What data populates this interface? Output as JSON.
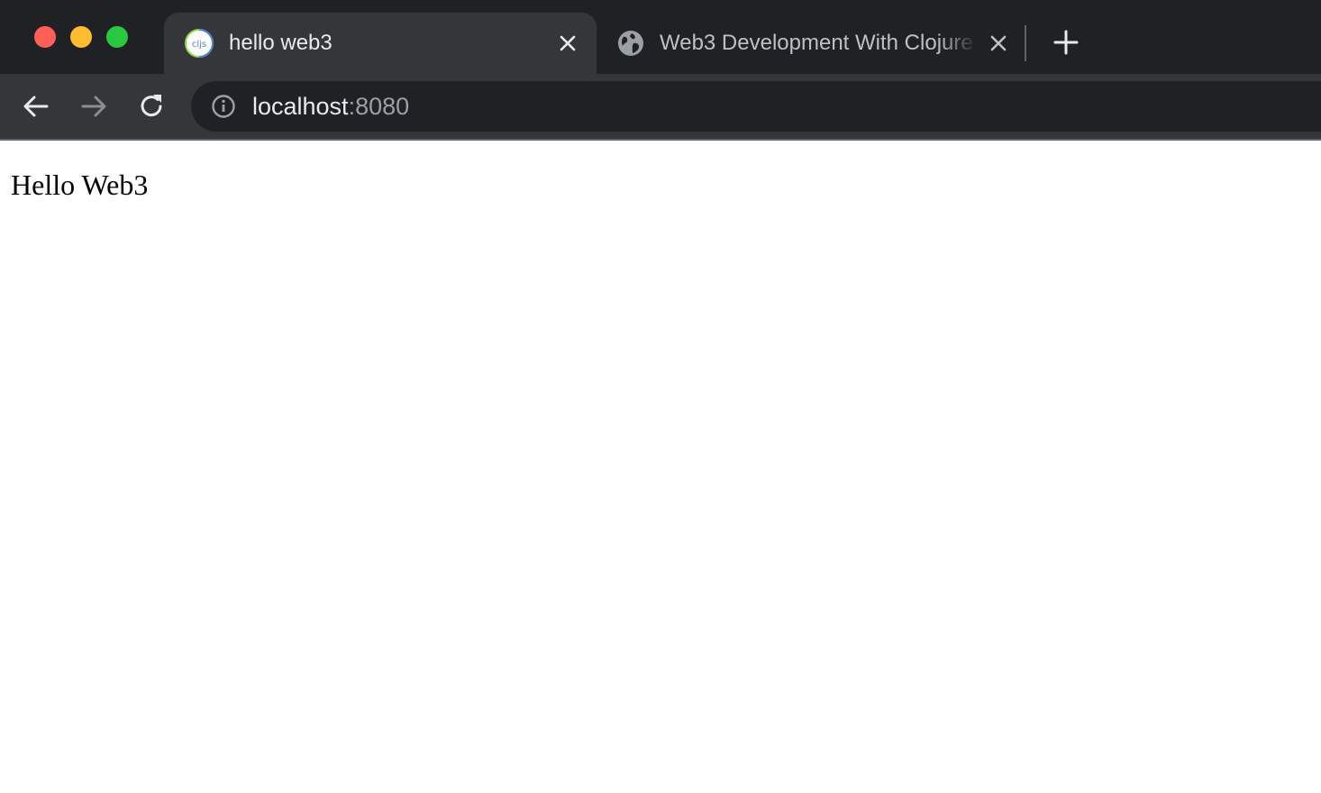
{
  "window": {
    "controls": [
      "close",
      "minimize",
      "maximize"
    ]
  },
  "tabs": [
    {
      "title": "hello web3",
      "active": true,
      "favicon": "cljs-logo-icon",
      "favicon_text": "cljs"
    },
    {
      "title": "Web3 Development With Clojure",
      "active": false,
      "favicon": "globe-icon"
    }
  ],
  "toolbar": {
    "back_icon": "arrow-left-icon",
    "forward_icon": "arrow-right-icon",
    "forward_enabled": false,
    "reload_icon": "reload-icon"
  },
  "omnibox": {
    "icon": "info-icon",
    "host": "localhost",
    "port": ":8080"
  },
  "page": {
    "body_text": "Hello Web3"
  },
  "colors": {
    "tabstrip_bg": "#202124",
    "active_tab_bg": "#35363a",
    "omnibox_bg": "#202124",
    "text_primary": "#e8eaed",
    "text_secondary": "#9aa0a6",
    "traffic_close": "#ff5f57",
    "traffic_minimize": "#febc2e",
    "traffic_maximize": "#28c840"
  }
}
